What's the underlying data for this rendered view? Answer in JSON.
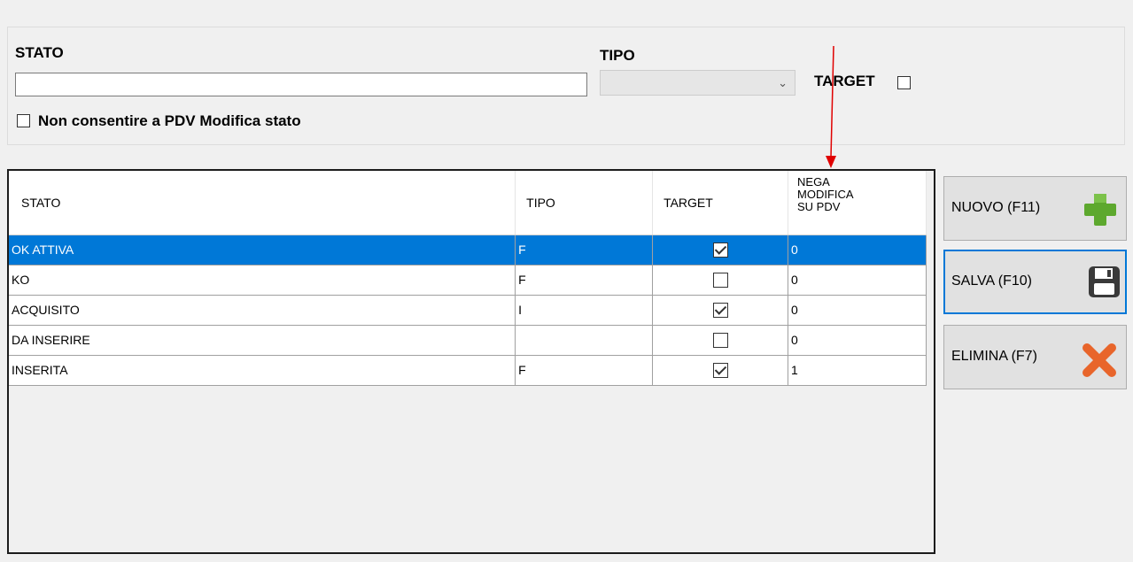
{
  "form": {
    "stato_label": "STATO",
    "stato_value": "",
    "tipo_label": "TIPO",
    "tipo_value": "",
    "target_label": "TARGET",
    "non_consentire_label": "Non consentire a PDV Modifica stato"
  },
  "table": {
    "headers": {
      "stato": "STATO",
      "tipo": "TIPO",
      "target": "TARGET",
      "nega_line1": "NEGA",
      "nega_line2": "MODIFICA",
      "nega_line3": "SU PDV"
    },
    "rows": [
      {
        "stato": "OK ATTIVA",
        "tipo": "F",
        "target": true,
        "nega": "0",
        "selected": true
      },
      {
        "stato": "KO",
        "tipo": "F",
        "target": false,
        "nega": "0",
        "selected": false
      },
      {
        "stato": "ACQUISITO",
        "tipo": "I",
        "target": true,
        "nega": "0",
        "selected": false
      },
      {
        "stato": "DA INSERIRE",
        "tipo": "",
        "target": false,
        "nega": "0",
        "selected": false
      },
      {
        "stato": "INSERITA",
        "tipo": "F",
        "target": true,
        "nega": "1",
        "selected": false
      }
    ]
  },
  "buttons": {
    "nuovo": "NUOVO (F11)",
    "salva": "SALVA (F10)",
    "elimina": "ELIMINA (F7)"
  },
  "icons": {
    "nuovo": "plus-icon",
    "salva": "floppy-disk-icon",
    "elimina": "delete-x-icon",
    "annotation": "red-arrow-icon"
  },
  "colors": {
    "selection": "#0078d7",
    "plus": "#5da82e",
    "delete": "#e8652b",
    "arrow": "#e00000"
  }
}
